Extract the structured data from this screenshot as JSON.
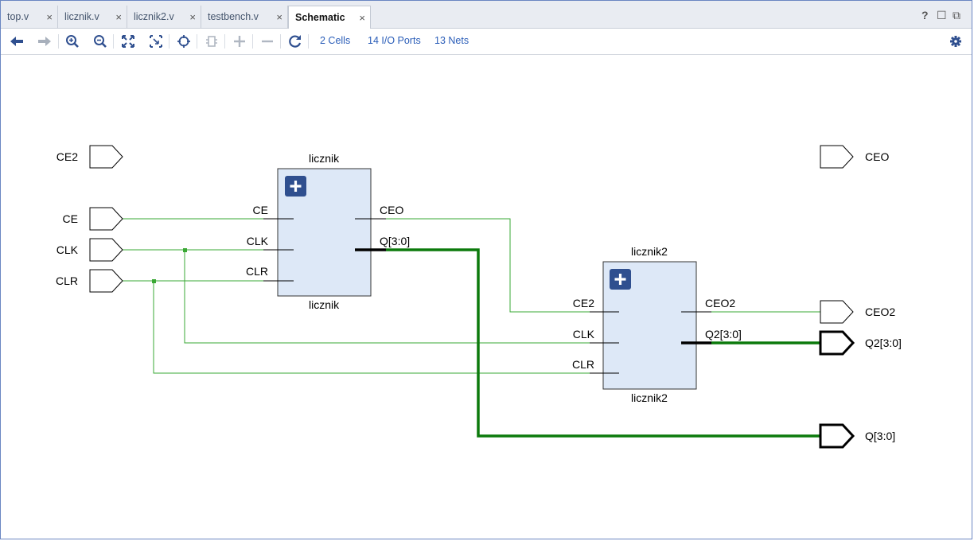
{
  "tabs": [
    {
      "label": "top.v"
    },
    {
      "label": "licznik.v"
    },
    {
      "label": "licznik2.v"
    },
    {
      "label": "testbench.v"
    },
    {
      "label": "Schematic"
    }
  ],
  "window_controls": {
    "help": "?",
    "restore": "☐",
    "float": "⧉"
  },
  "toolbar": {
    "cells_link": "2 Cells",
    "ports_link": "14 I/O Ports",
    "nets_link": "13 Nets"
  },
  "schematic": {
    "input_ports": [
      "CE2",
      "CE",
      "CLK",
      "CLR"
    ],
    "output_ports": [
      "CEO",
      "CEO2",
      "Q2[3:0]",
      "Q[3:0]"
    ],
    "cell1": {
      "name_top": "licznik",
      "name_bottom": "licznik",
      "inputs": [
        "CE",
        "CLK",
        "CLR"
      ],
      "outputs": [
        "CEO",
        "Q[3:0]"
      ]
    },
    "cell2": {
      "name_top": "licznik2",
      "name_bottom": "licznik2",
      "inputs": [
        "CE2",
        "CLK",
        "CLR"
      ],
      "outputs": [
        "CEO2",
        "Q2[3:0]"
      ]
    }
  },
  "colors": {
    "net": "#3aa834",
    "bus": "#0c7a0c",
    "cell_fill": "#dde8f7",
    "expand_button": "#2f4f8f",
    "accent_link": "#2a5db8"
  },
  "icons": [
    "back-arrow-icon",
    "forward-arrow-icon",
    "zoom-in-icon",
    "zoom-out-icon",
    "zoom-fit-icon",
    "zoom-area-icon",
    "crosshair-icon",
    "collapse-icon",
    "expand-plus-icon",
    "collapse-minus-icon",
    "refresh-icon",
    "settings-gear-icon"
  ]
}
